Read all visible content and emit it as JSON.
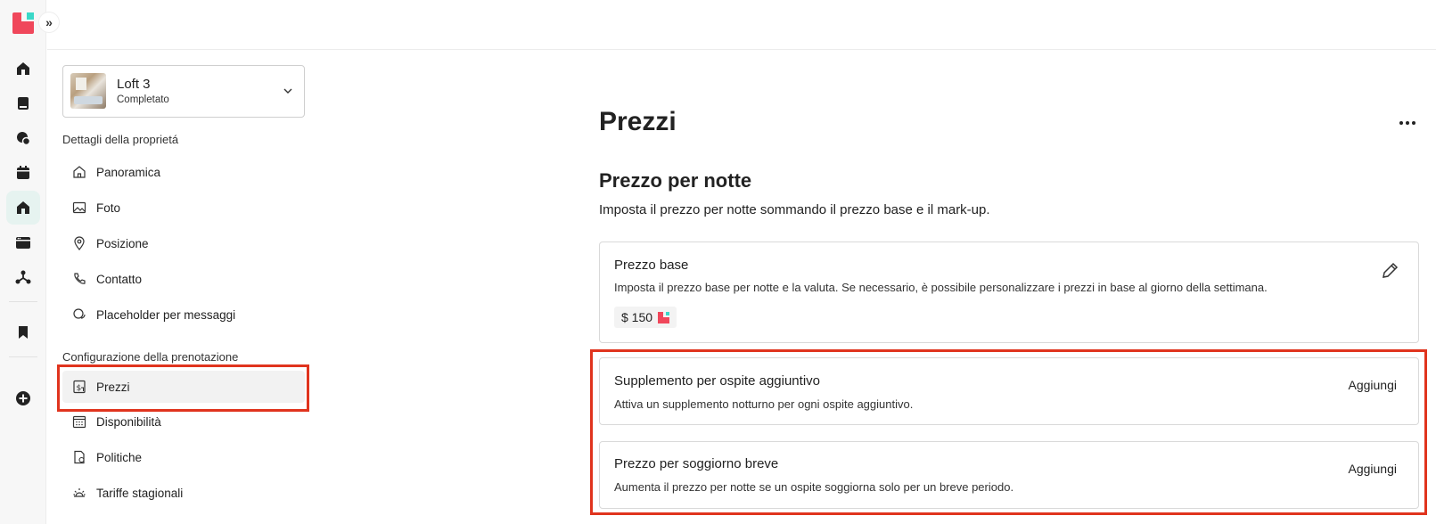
{
  "property": {
    "name": "Loft 3",
    "status": "Completato"
  },
  "sidebar": {
    "section1_title": "Dettagli della proprietá",
    "section1_items": [
      {
        "label": "Panoramica",
        "icon": "home-outline-icon"
      },
      {
        "label": "Foto",
        "icon": "image-icon"
      },
      {
        "label": "Posizione",
        "icon": "location-pin-icon"
      },
      {
        "label": "Contatto",
        "icon": "phone-icon"
      },
      {
        "label": "Placeholder per messaggi",
        "icon": "chat-bubbles-icon"
      }
    ],
    "section2_title": "Configurazione della prenotazione",
    "section2_items": [
      {
        "label": "Prezzi",
        "icon": "price-tag-icon",
        "selected": true
      },
      {
        "label": "Disponibilità",
        "icon": "calendar-grid-icon"
      },
      {
        "label": "Politiche",
        "icon": "document-check-icon"
      },
      {
        "label": "Tariffe stagionali",
        "icon": "sun-icon"
      }
    ]
  },
  "main": {
    "title": "Prezzi",
    "section_title": "Prezzo per notte",
    "section_subtitle": "Imposta il prezzo per notte sommando il prezzo base e il mark-up.",
    "cards": [
      {
        "title": "Prezzo base",
        "description": "Imposta il prezzo base per notte e la valuta. Se necessario, è possibile personalizzare i prezzi in base al giorno della settimana.",
        "price": "$ 150"
      },
      {
        "title": "Supplemento per ospite aggiuntivo",
        "description": "Attiva un supplemento notturno per ogni ospite aggiuntivo.",
        "action": "Aggiungi"
      },
      {
        "title": "Prezzo per soggiorno breve",
        "description": "Aumenta il prezzo per notte se un ospite soggiorna solo per un breve periodo.",
        "action": "Aggiungi"
      }
    ]
  },
  "colors": {
    "brand_red": "#f0475b",
    "brand_teal": "#3ad8c8",
    "highlight": "#e0341e",
    "active_rail_bg": "#e6f3f0"
  }
}
